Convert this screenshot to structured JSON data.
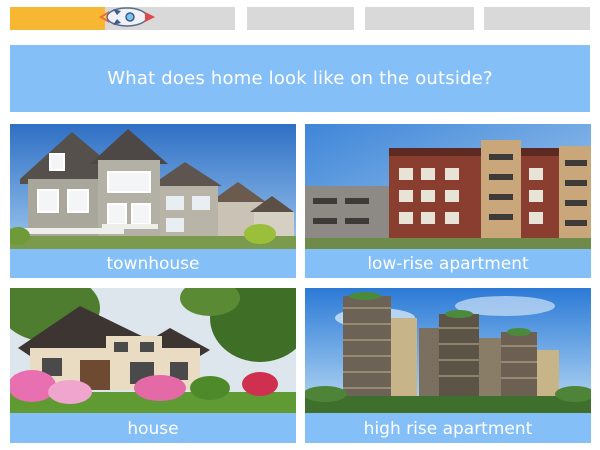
{
  "progress": {
    "segments": 4,
    "current_segment": 1,
    "fill_fraction": 0.42,
    "colors": {
      "fill": "#f7b733",
      "empty": "#d9d9d9"
    },
    "marker_icon": "rocket-icon"
  },
  "question": {
    "text": "What does home look like on the outside?",
    "background": "#84bff7"
  },
  "options": [
    {
      "label": "townhouse",
      "image": "townhouse-photo"
    },
    {
      "label": "low-rise apartment",
      "image": "low-rise-apartment-photo"
    },
    {
      "label": "house",
      "image": "house-photo"
    },
    {
      "label": "high rise apartment",
      "image": "high-rise-apartment-photo"
    }
  ],
  "colors": {
    "accent": "#84bff7",
    "text_on_accent": "#ffffff"
  }
}
